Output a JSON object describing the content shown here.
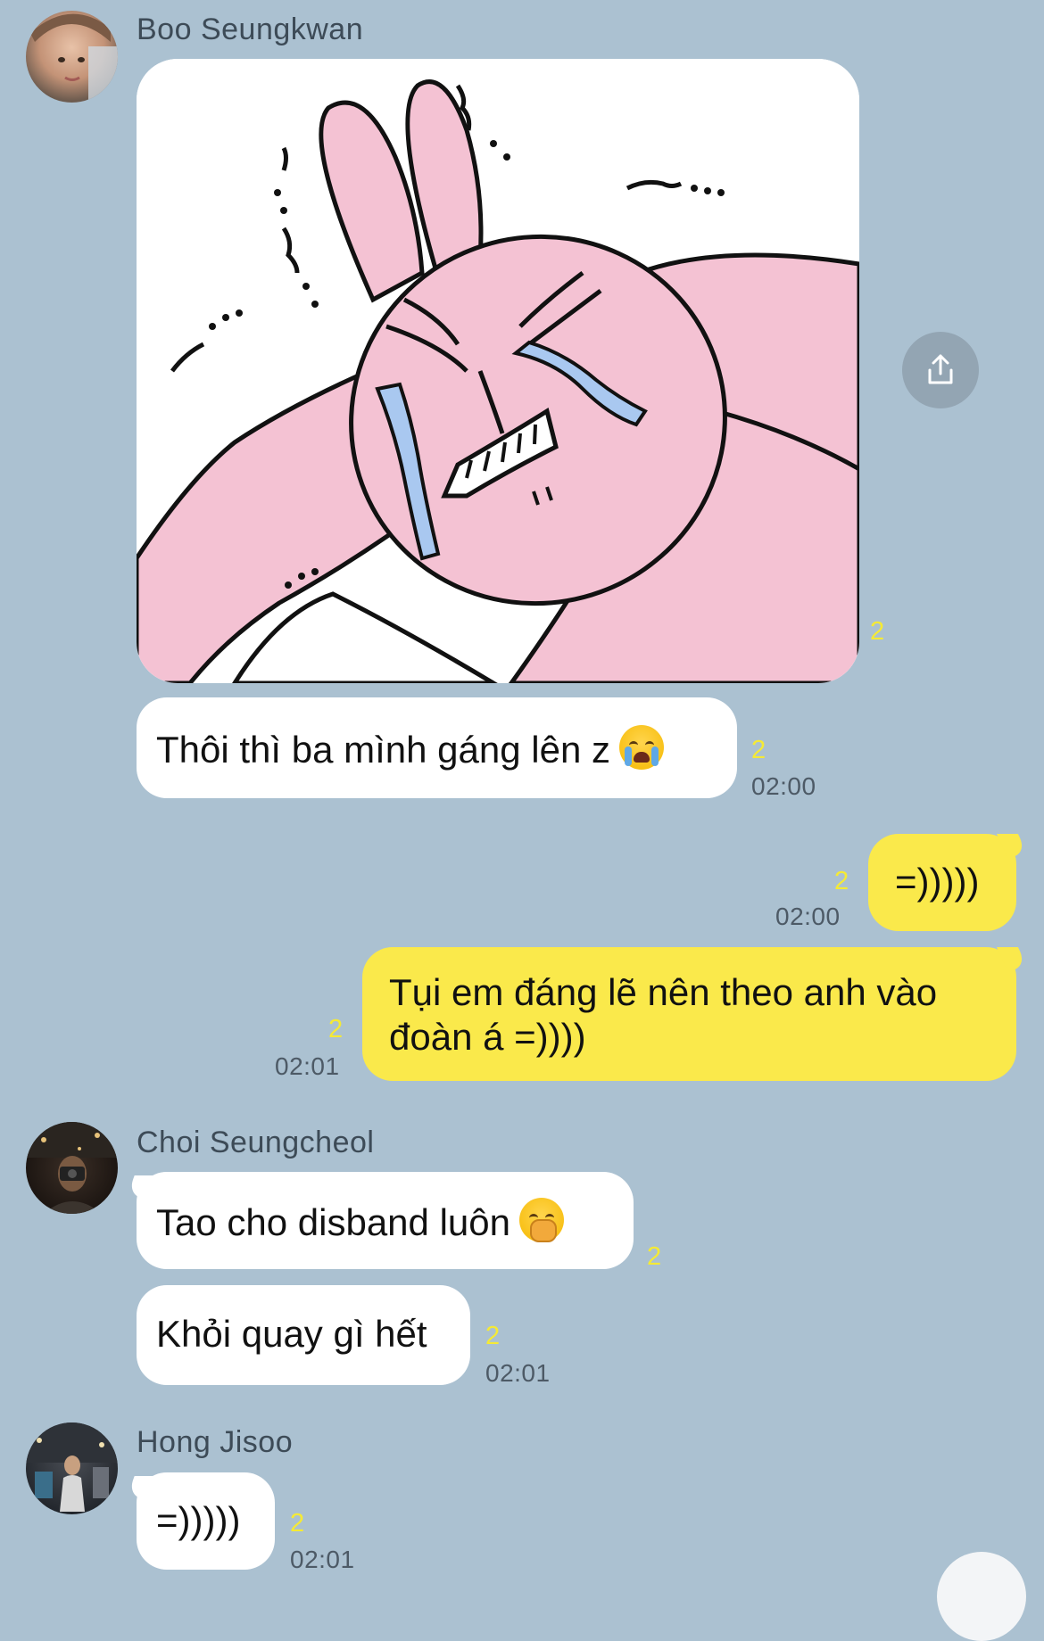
{
  "messages": [
    {
      "type": "sender",
      "name": "Boo Seungkwan"
    },
    {
      "type": "sticker",
      "description": "pink crying rabbit sticker",
      "unread": "2"
    },
    {
      "type": "text",
      "text": "Thôi thì ba mình gáng lên z",
      "emoji": "crying-face",
      "unread": "2",
      "time": "02:00"
    },
    {
      "type": "outgoing",
      "text": "=)))))",
      "unread": "2",
      "time": "02:00"
    },
    {
      "type": "outgoing",
      "text_line1": "Tụi em đáng lẽ nên theo anh vào",
      "text_line2": "đoàn á =))))",
      "unread": "2",
      "time": "02:01"
    },
    {
      "type": "sender",
      "name": "Choi Seungcheol"
    },
    {
      "type": "text",
      "text": "Tao cho disband luôn",
      "emoji": "yawning-face",
      "unread": "2"
    },
    {
      "type": "text",
      "text": "Khỏi quay gì hết",
      "unread": "2",
      "time": "02:01"
    },
    {
      "type": "sender",
      "name": "Hong Jisoo"
    },
    {
      "type": "text",
      "text": "=)))))",
      "unread": "2",
      "time": "02:01"
    }
  ],
  "colors": {
    "background": "#abc1d1",
    "incoming_bubble": "#ffffff",
    "outgoing_bubble": "#fae94b",
    "unread_count": "#f5ea35",
    "timestamp": "#4d5a66",
    "sticker_pink": "#f4c2d3",
    "sticker_tears": "#a9c8f0"
  }
}
